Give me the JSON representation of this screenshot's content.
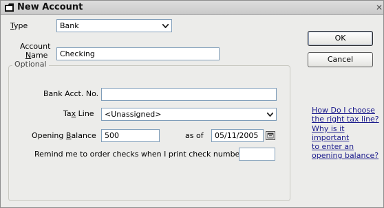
{
  "window": {
    "title": "New Account",
    "title_icon": "folder-icon",
    "close_glyph": "✕"
  },
  "type": {
    "label_pre": "",
    "label_u": "T",
    "label_post": "ype",
    "value": "Bank"
  },
  "account_name": {
    "label_line1": "Account",
    "label_u": "N",
    "label_line2_post": "ame",
    "value": "Checking"
  },
  "buttons": {
    "ok": "OK",
    "cancel": "Cancel"
  },
  "optional": {
    "title": "Optional",
    "bank_acct_label": "Bank Acct. No.",
    "bank_acct_value": "",
    "tax_line_label_pre": "Ta",
    "tax_line_label_u": "x",
    "tax_line_label_post": " Line",
    "tax_line_value": "<Unassigned>",
    "opening_balance_label_pre": "Opening ",
    "opening_balance_label_u": "B",
    "opening_balance_label_post": "alance",
    "opening_balance_value": "500",
    "as_of_label": "as of",
    "as_of_value": "05/11/2005",
    "remind_label": "Remind me to order checks when I print check number",
    "remind_value": ""
  },
  "help_links": {
    "tax_line_help": [
      "How Do I choose",
      "the right tax line?"
    ],
    "opening_balance_help": [
      "Why is it important",
      "to enter an",
      "opening balance?"
    ]
  },
  "colors": {
    "link": "#1a1a8c",
    "window_bg": "#ececea"
  }
}
